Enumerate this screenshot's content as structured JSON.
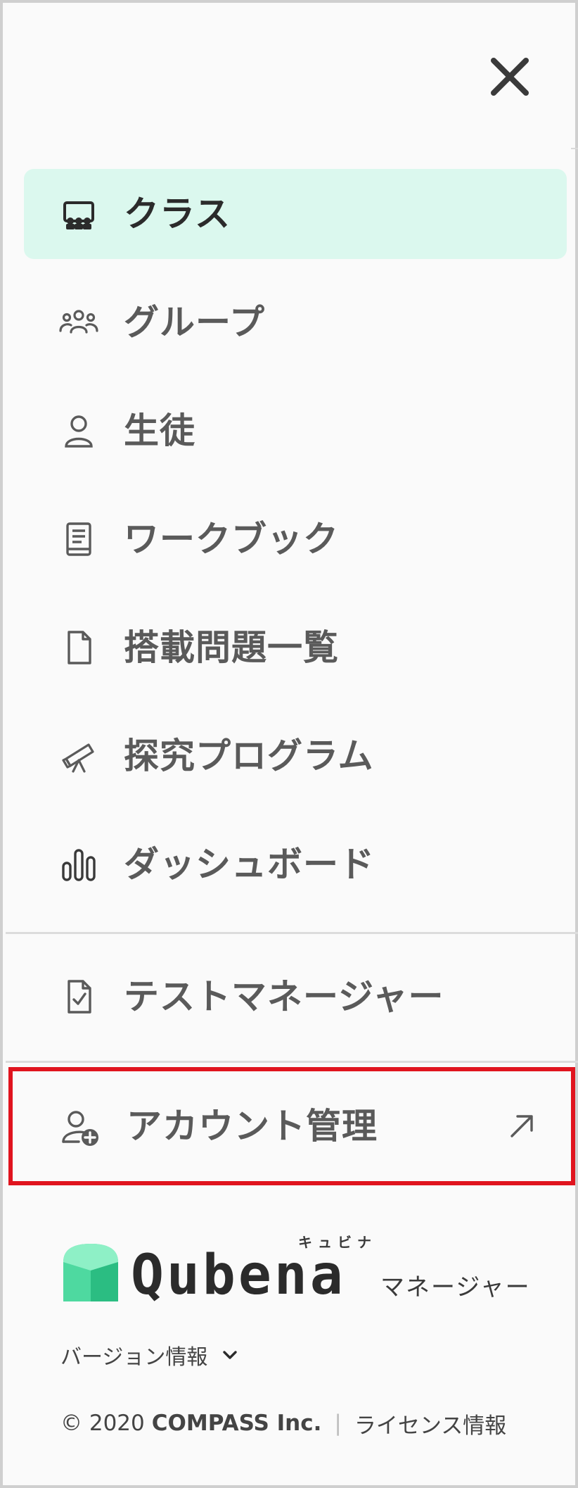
{
  "menu": {
    "close_icon": "close-icon",
    "items": [
      {
        "label": "クラス",
        "icon": "class-icon",
        "active": true
      },
      {
        "label": "グループ",
        "icon": "group-icon",
        "active": false
      },
      {
        "label": "生徒",
        "icon": "user-icon",
        "active": false
      },
      {
        "label": "ワークブック",
        "icon": "book-icon",
        "active": false
      },
      {
        "label": "搭載問題一覧",
        "icon": "file-icon",
        "active": false
      },
      {
        "label": "探究プログラム",
        "icon": "telescope-icon",
        "active": false
      },
      {
        "label": "ダッシュボード",
        "icon": "bar-chart-icon",
        "active": false
      }
    ],
    "test_manager": {
      "label": "テストマネージャー",
      "icon": "document-check-icon"
    },
    "account": {
      "label": "アカウント管理",
      "icon": "user-add-icon",
      "external_icon": "external-link-icon",
      "highlighted": true
    }
  },
  "branding": {
    "logo_word": "Qubena",
    "logo_ruby": "キュビナ",
    "logo_suffix": "マネージャー",
    "accent_color": "#4ed9a0"
  },
  "version": {
    "label": "バージョン情報"
  },
  "footer": {
    "copyright": "© 2020",
    "company": "COMPASS Inc.",
    "separator": "|",
    "license_link": "ライセンス情報"
  },
  "colors": {
    "active_bg": "#dbf8ee",
    "highlight_border": "#e0141e",
    "text": "#5a5a5a"
  }
}
